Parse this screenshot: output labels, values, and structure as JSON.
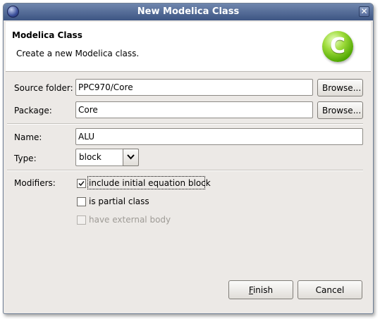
{
  "window": {
    "title": "New Modelica Class",
    "close_glyph": "✕"
  },
  "header": {
    "title": "Modelica Class",
    "description": "Create a new Modelica class.",
    "logo_letter": "C",
    "logo_icon": "modelica-class-logo-icon"
  },
  "form": {
    "source_folder": {
      "label": "Source folder:",
      "value": "PPC970/Core",
      "browse_label": "Browse..."
    },
    "package": {
      "label": "Package:",
      "value": "Core",
      "browse_label": "Browse..."
    },
    "name": {
      "label": "Name:",
      "value": "ALU"
    },
    "type": {
      "label": "Type:",
      "value": "block"
    },
    "modifiers": {
      "label": "Modifiers:",
      "options": [
        {
          "label": "include initial equation block",
          "checked": true,
          "enabled": true
        },
        {
          "label": "is partial class",
          "checked": false,
          "enabled": true
        },
        {
          "label": "have external body",
          "checked": false,
          "enabled": false
        }
      ]
    }
  },
  "buttons": {
    "finish_label": "Finish",
    "cancel_label": "Cancel"
  },
  "colors": {
    "titlebar_top": "#6f86ad",
    "titlebar_bottom": "#3d5583",
    "dialog_bg": "#ece9e6",
    "logo_green": "#4ea600"
  }
}
